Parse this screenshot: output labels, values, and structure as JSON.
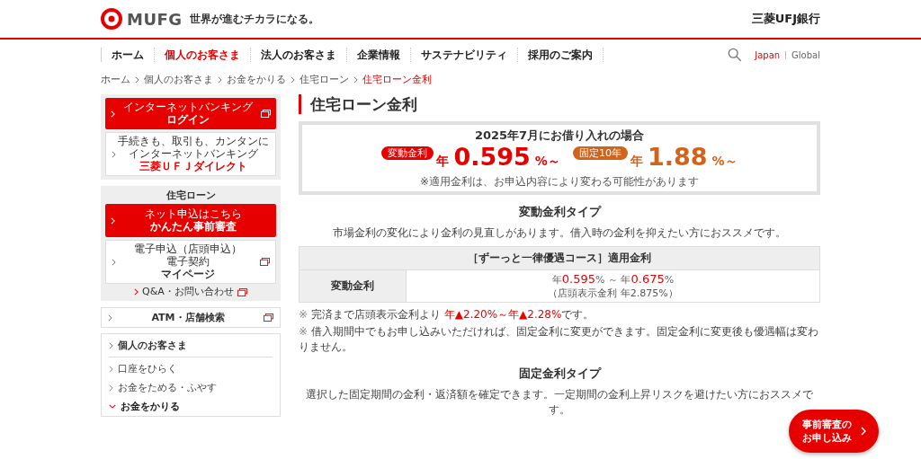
{
  "header": {
    "logo_text": "MUFG",
    "tagline": "世界が進むチカラになる。",
    "bank_name": "三菱UFJ銀行"
  },
  "nav": {
    "items": [
      {
        "label": "ホーム",
        "selected": false
      },
      {
        "label": "個人のお客さま",
        "selected": true
      },
      {
        "label": "法人のお客さま",
        "selected": false
      },
      {
        "label": "企業情報",
        "selected": false
      },
      {
        "label": "サステナビリティ",
        "selected": false
      },
      {
        "label": "採用のご案内",
        "selected": false
      }
    ],
    "languages": [
      {
        "label": "Japan",
        "selected": true
      },
      {
        "label": "Global",
        "selected": false
      }
    ]
  },
  "breadcrumbs": [
    {
      "label": "ホーム",
      "current": false
    },
    {
      "label": "個人のお客さま",
      "current": false
    },
    {
      "label": "お金をかりる",
      "current": false
    },
    {
      "label": "住宅ローン",
      "current": false
    },
    {
      "label": "住宅ローン金利",
      "current": true
    }
  ],
  "sidebar": {
    "login": {
      "subtitle": "インターネットバンキング",
      "title": "ログイン"
    },
    "direct": {
      "lines": [
        "手続きも、取引も、カンタンに",
        "インターネットバンキング"
      ],
      "title": "三菱ＵＦＪダイレクト"
    },
    "loan_panel": {
      "heading": "住宅ローン",
      "apply": {
        "subtitle": "ネット申込はこちら",
        "title": "かんたん事前審査"
      },
      "mypage": {
        "lines": [
          "電子申込（店頭申込）",
          "電子契約"
        ],
        "title": "マイページ"
      },
      "qa_link": "Q&A・お問い合わせ"
    },
    "atm_link": "ATM・店舗検索",
    "menu": {
      "heading": "個人のお客さま",
      "items": [
        {
          "label": "口座をひらく",
          "expanded": false
        },
        {
          "label": "お金をためる・ふやす",
          "expanded": false
        },
        {
          "label": "お金をかりる",
          "expanded": true
        }
      ]
    }
  },
  "main": {
    "title": "住宅ローン金利",
    "rate_box": {
      "heading": "2025年7月にお借り入れの場合",
      "rates": [
        {
          "badge": "変動金利",
          "prefix": "年",
          "value": "0.595",
          "suffix": "%～",
          "color": "#e60000"
        },
        {
          "badge": "固定10年",
          "prefix": "年",
          "value": "1.88",
          "suffix": "%～",
          "color": "#d0641c"
        }
      ],
      "note": "※適用金利は、お申込内容により変わる可能性があります"
    },
    "variable": {
      "heading": "変動金利タイプ",
      "description": "市場金利の変化により金利の見直しがあります。借入時の金利を抑えたい方におススメです。",
      "table": {
        "header": "［ずーっと一律優遇コース］適用金利",
        "row_label": "変動金利",
        "prefix_from": "年",
        "rate_from": "0.595",
        "suffix_from": "%",
        "separator": "～",
        "prefix_to": "年",
        "rate_to": "0.675",
        "suffix_to": "%",
        "store_rate": "（店頭表示金利 年2.875%）"
      },
      "notes": [
        {
          "mark": "※",
          "before": "完済まで店頭表示金利より",
          "highlight": "年▲2.20%～年▲2.28%",
          "after": "です。"
        },
        {
          "mark": "※",
          "before": "借入期間中でもお申し込みいただければ、固定金利に変更ができます。固定金利に変更後も優遇幅は変わりません。"
        }
      ]
    },
    "fixed": {
      "heading": "固定金利タイプ",
      "description": "選択した固定期間の金利・返済額を確定できます。一定期間の金利上昇リスクを避けたい方におススメです。"
    }
  },
  "floating_button": {
    "lines": [
      "事前審査の",
      "お申し込み"
    ]
  }
}
